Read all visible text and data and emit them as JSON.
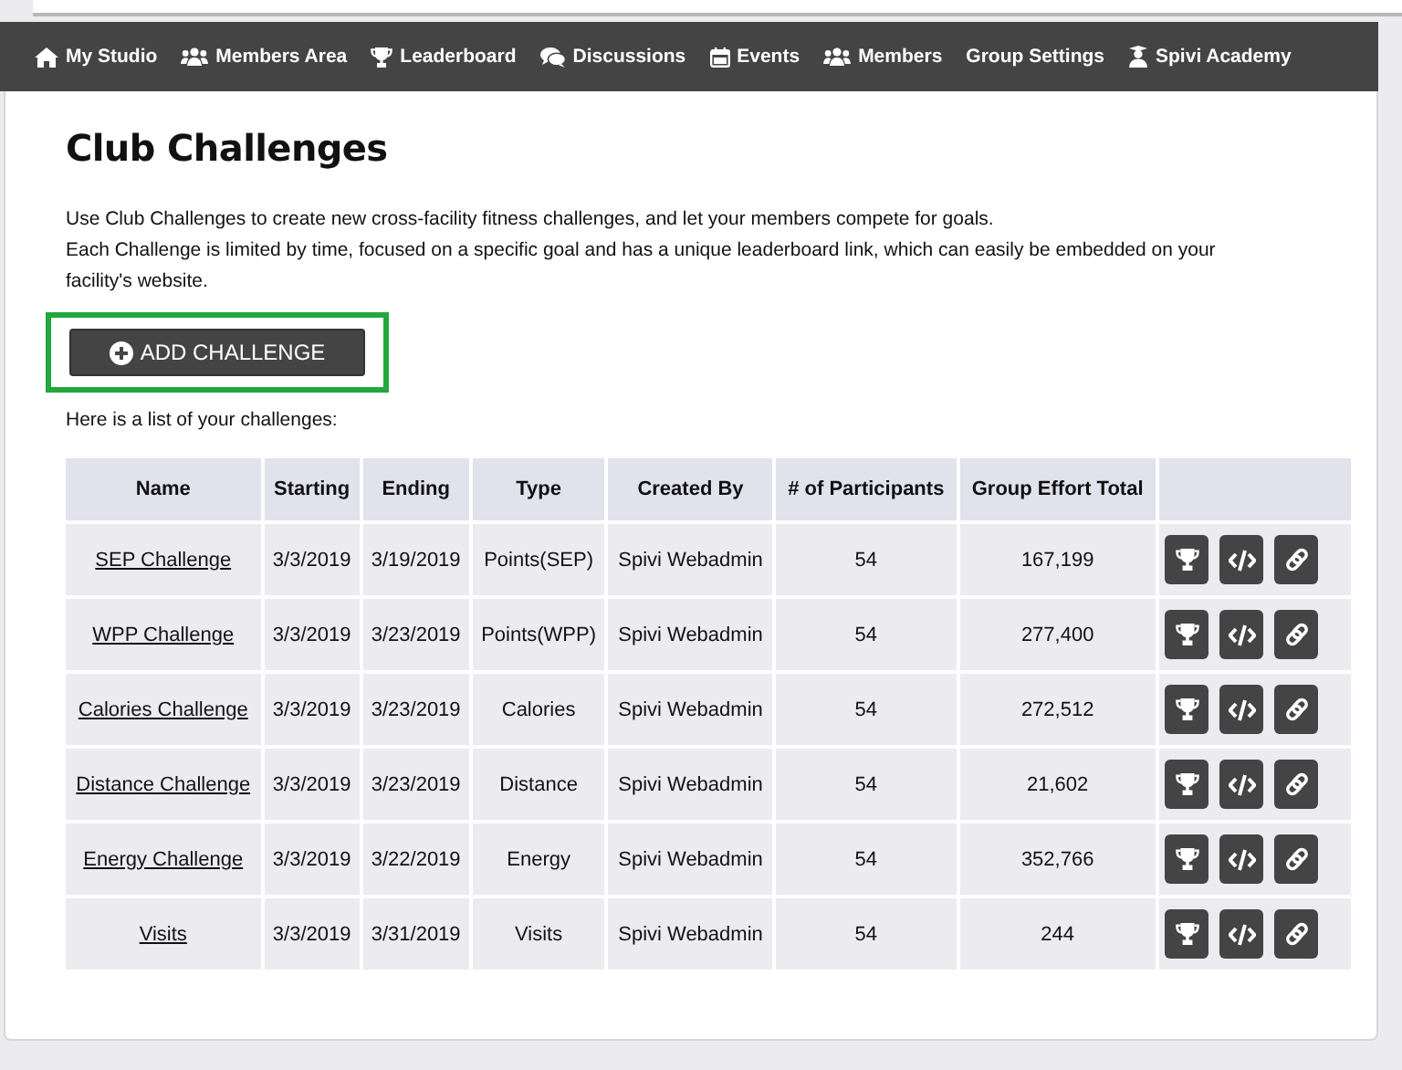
{
  "nav": [
    {
      "label": "My Studio",
      "kind": "home"
    },
    {
      "label": "Members Area",
      "kind": "users"
    },
    {
      "label": "Leaderboard",
      "kind": "trophy"
    },
    {
      "label": "Discussions",
      "kind": "comments"
    },
    {
      "label": "Events",
      "kind": "calendar"
    },
    {
      "label": "Members",
      "kind": "users"
    },
    {
      "label": "Group Settings",
      "kind": "plain"
    },
    {
      "label": "Spivi Academy",
      "kind": "graduate"
    }
  ],
  "title": "Club Challenges",
  "intro": [
    "Use Club Challenges to create new cross-facility fitness challenges, and let your members compete for goals.",
    "Each Challenge is limited by time, focused on a specific goal and has a unique leaderboard link, which can easily be embedded on your facility's website."
  ],
  "add_button": {
    "label": "ADD CHALLENGE",
    "highlighted": true
  },
  "list_caption": "Here is a list of your challenges:",
  "table": {
    "columns": [
      "Name",
      "Starting",
      "Ending",
      "Type",
      "Created By",
      "# of Participants",
      "Group Effort Total"
    ],
    "rows": [
      [
        "SEP Challenge",
        "3/3/2019",
        "3/19/2019",
        "Points(SEP)",
        "Spivi Webadmin",
        "54",
        "167,199"
      ],
      [
        "WPP Challenge",
        "3/3/2019",
        "3/23/2019",
        "Points(WPP)",
        "Spivi Webadmin",
        "54",
        "277,400"
      ],
      [
        "Calories Challenge",
        "3/3/2019",
        "3/23/2019",
        "Calories",
        "Spivi Webadmin",
        "54",
        "272,512"
      ],
      [
        "Distance Challenge",
        "3/3/2019",
        "3/23/2019",
        "Distance",
        "Spivi Webadmin",
        "54",
        "21,602"
      ],
      [
        "Energy Challenge",
        "3/3/2019",
        "3/22/2019",
        "Energy",
        "Spivi Webadmin",
        "54",
        "352,766"
      ],
      [
        "Visits",
        "3/3/2019",
        "3/31/2019",
        "Visits",
        "Spivi Webadmin",
        "54",
        "244"
      ]
    ]
  }
}
